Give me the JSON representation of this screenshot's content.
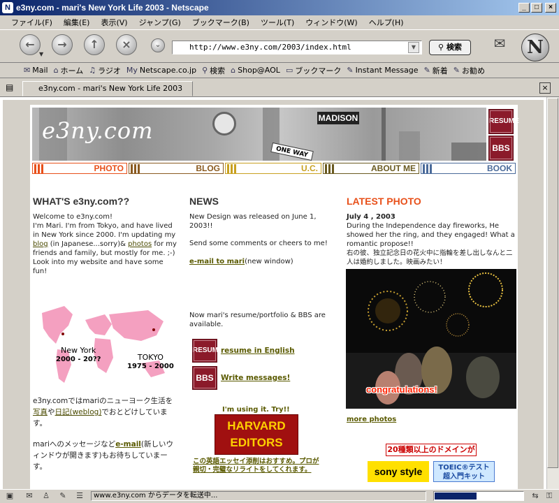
{
  "window": {
    "title": "e3ny.com - mari's New York Life 2003 - Netscape",
    "app_icon": "N"
  },
  "menu": [
    "ファイル(F)",
    "編集(E)",
    "表示(V)",
    "ジャンプ(G)",
    "ブックマーク(B)",
    "ツール(T)",
    "ウィンドウ(W)",
    "ヘルプ(H)"
  ],
  "nav": {
    "url": "http://www.e3ny.com/2003/index.html",
    "search_label": "検索"
  },
  "personal_toolbar": [
    {
      "icon": "✉",
      "label": "Mail"
    },
    {
      "icon": "⌂",
      "label": "ホーム"
    },
    {
      "icon": "♫",
      "label": "ラジオ"
    },
    {
      "icon": "My",
      "label": "Netscape.co.jp"
    },
    {
      "icon": "⚲",
      "label": "検索"
    },
    {
      "icon": "⌂",
      "label": "Shop@AOL"
    },
    {
      "icon": "▭",
      "label": "ブックマーク"
    },
    {
      "icon": "✎",
      "label": "Instant Message"
    },
    {
      "icon": "✎",
      "label": "新着"
    },
    {
      "icon": "✎",
      "label": "お勧め"
    }
  ],
  "tab": {
    "label": "e3ny.com - mari's New York Life 2003"
  },
  "site": {
    "logo": "e3ny.com",
    "street_sign": "MADISON",
    "oneway_sign": "ONE WAY",
    "resume_btn": "RESUME",
    "bbs_btn": "BBS",
    "nav_tabs": [
      {
        "label": "PHOTO",
        "color": "#e8501a"
      },
      {
        "label": "BLOG",
        "color": "#8a5a20"
      },
      {
        "label": "U.C.",
        "color": "#c8a020"
      },
      {
        "label": "ABOUT ME",
        "color": "#6a5a20"
      },
      {
        "label": "BOOK",
        "color": "#4a6a9a"
      }
    ]
  },
  "whats": {
    "title": "WHAT'S e3ny.com??",
    "p1": "Welcome to e3ny.com!",
    "p2": "I'm Mari. I'm from Tokyo, and have lived in New York since 2000. I'm updating my",
    "blog_link": "blog",
    "p3": "(in Japanese...sorry)&",
    "photos_link": "photos",
    "p4": "for my friends and family, but mostly for me. ;-)",
    "p5": "Look into my website and have some fun!",
    "map_ny": "New York",
    "map_ny_years": "2000 - 20??",
    "map_tokyo": "TOKYO",
    "map_tokyo_years": "1975 - 2000",
    "jp1": "e3ny.comではmariのニューヨーク生活を",
    "jp_photo_link": "写真",
    "jp2": "や",
    "jp_diary_link": "日記(weblog)",
    "jp3": "でおとどけしています。",
    "jp4": "mariへのメッセージなど",
    "jp_email_link": "e-mail",
    "jp5": "(新しいウィンドウが開きます)もお待ちしていまーす。"
  },
  "news": {
    "title": "NEWS",
    "p1": "New Design was released on June 1, 2003!!",
    "p2": "Send some comments or cheers to me!",
    "email_link": "e-mail to mari",
    "email_note": "(new window)",
    "p3": "Now mari's resume/portfolio & BBS are available.",
    "resume_link": "resume in English",
    "bbs_link": "Write messages!",
    "ad_caption": "I'm using it. Try!!",
    "harvard_line1": "HARVARD",
    "harvard_line2": "EDITORS",
    "ad_link": "この英語エッセイ添削はおすすめ。プロが親切・完璧なリライトをしてくれます。"
  },
  "latest": {
    "title": "LATEST PHOTO",
    "date": "July 4 , 2003",
    "p1": "During the Independence day fireworks, He showed her the ring, and they engaged! What a romantic propose!!",
    "jp": "右の彼、独立記念日の花火中に指輪を差し出しなんと二人は婚約しました。映画みたい！",
    "photo_caption": "congratulations!",
    "more_link": "more photos",
    "domain_ad": "20種類以上のドメインが",
    "sony_ad": "sony style",
    "toeic_ad_line1": "TOEIC®テスト",
    "toeic_ad_line2": "超入門キット"
  },
  "status": {
    "text": "www.e3ny.com からデータを転送中..."
  }
}
